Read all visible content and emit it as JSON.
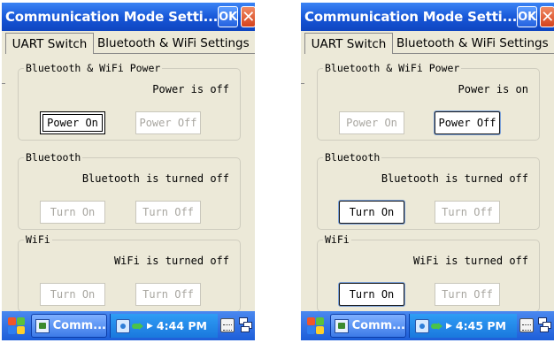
{
  "screens": [
    {
      "title": "Communication Mode Setti...",
      "ok_label": "OK",
      "close_label": "✕",
      "tabs": [
        "UART Switch",
        "Bluetooth & WiFi Settings"
      ],
      "groups": [
        {
          "legend": "Bluetooth & WiFi Power",
          "status": "Power is off",
          "buttons": [
            {
              "label": "Power On",
              "state": "enabled-focused"
            },
            {
              "label": "Power Off",
              "state": "disabled"
            }
          ]
        },
        {
          "legend": "Bluetooth",
          "status": "Bluetooth is turned off",
          "buttons": [
            {
              "label": "Turn On",
              "state": "disabled"
            },
            {
              "label": "Turn Off",
              "state": "disabled"
            }
          ]
        },
        {
          "legend": "WiFi",
          "status": "WiFi is turned off",
          "buttons": [
            {
              "label": "Turn On",
              "state": "disabled"
            },
            {
              "label": "Turn Off",
              "state": "disabled"
            }
          ]
        }
      ],
      "taskbar": {
        "app_label": "Comm...",
        "clock": "4:44 PM"
      }
    },
    {
      "title": "Communication Mode Setti...",
      "ok_label": "OK",
      "close_label": "✕",
      "tabs": [
        "UART Switch",
        "Bluetooth & WiFi Settings"
      ],
      "groups": [
        {
          "legend": "Bluetooth & WiFi Power",
          "status": "Power is on",
          "buttons": [
            {
              "label": "Power On",
              "state": "disabled"
            },
            {
              "label": "Power Off",
              "state": "enabled"
            }
          ]
        },
        {
          "legend": "Bluetooth",
          "status": "Bluetooth is turned off",
          "buttons": [
            {
              "label": "Turn On",
              "state": "enabled"
            },
            {
              "label": "Turn Off",
              "state": "disabled"
            }
          ]
        },
        {
          "legend": "WiFi",
          "status": "WiFi is turned off",
          "buttons": [
            {
              "label": "Turn On",
              "state": "enabled"
            },
            {
              "label": "Turn Off",
              "state": "disabled"
            }
          ]
        }
      ],
      "taskbar": {
        "app_label": "Comm...",
        "clock": "4:45 PM"
      }
    }
  ],
  "icons": [
    "start-flag-icon",
    "app-window-icon",
    "network-icon",
    "sync-icon",
    "tray-arrow-icon",
    "keyboard-icon",
    "desktop-icon"
  ],
  "colors": {
    "title_bar": "#1655d6",
    "taskbar": "#2a6be0",
    "window_bg": "#ece9d8",
    "close_button": "#d5421b",
    "ok_button": "#2462e0"
  }
}
